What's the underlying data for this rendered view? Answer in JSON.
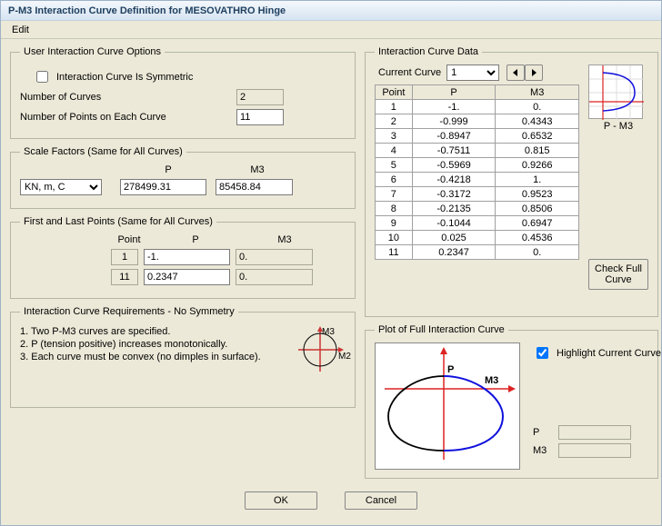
{
  "window": {
    "title": "P-M3 Interaction Curve Definition for MESOVATHRO Hinge"
  },
  "menu": {
    "edit": "Edit"
  },
  "userOptions": {
    "legend": "User Interaction Curve Options",
    "symmetric_label": "Interaction Curve Is Symmetric",
    "symmetric_checked": false,
    "num_curves_label": "Number of Curves",
    "num_curves_value": "2",
    "num_points_label": "Number of Points on Each Curve",
    "num_points_value": "11"
  },
  "scaleFactors": {
    "legend": "Scale Factors (Same for All Curves)",
    "units_dropdown": "KN, m, C",
    "hdr_p": "P",
    "hdr_m3": "M3",
    "p_value": "278499.31",
    "m3_value": "85458.84"
  },
  "firstLast": {
    "legend": "First and Last Points (Same for All Curves)",
    "hdr_point": "Point",
    "hdr_p": "P",
    "hdr_m3": "M3",
    "r1_point": "1",
    "r1_p": "-1.",
    "r1_m3": "0.",
    "r2_point": "11",
    "r2_p": "0.2347",
    "r2_m3": "0."
  },
  "requirements": {
    "legend": "Interaction Curve Requirements - No Symmetry",
    "item1": "1.  Two P-M3 curves are specified.",
    "item2": "2.  P (tension positive) increases monotonically.",
    "item3": "3.  Each curve must be convex (no dimples in surface).",
    "axis_p": "M3",
    "axis_m3": "M2"
  },
  "curveData": {
    "legend": "Interaction Curve Data",
    "current_curve_label": "Current Curve",
    "current_curve_value": "1",
    "col_point": "Point",
    "col_p": "P",
    "col_m3": "M3",
    "rows": [
      {
        "pt": "1",
        "p": "-1.",
        "m3": "0."
      },
      {
        "pt": "2",
        "p": "-0.999",
        "m3": "0.4343"
      },
      {
        "pt": "3",
        "p": "-0.8947",
        "m3": "0.6532"
      },
      {
        "pt": "4",
        "p": "-0.7511",
        "m3": "0.815"
      },
      {
        "pt": "5",
        "p": "-0.5969",
        "m3": "0.9266"
      },
      {
        "pt": "6",
        "p": "-0.4218",
        "m3": "1."
      },
      {
        "pt": "7",
        "p": "-0.3172",
        "m3": "0.9523"
      },
      {
        "pt": "8",
        "p": "-0.2135",
        "m3": "0.8506"
      },
      {
        "pt": "9",
        "p": "-0.1044",
        "m3": "0.6947"
      },
      {
        "pt": "10",
        "p": "0.025",
        "m3": "0.4536"
      },
      {
        "pt": "11",
        "p": "0.2347",
        "m3": "0."
      }
    ],
    "miniplot_label": "P - M3",
    "check_full_btn": "Check Full Curve"
  },
  "fullPlot": {
    "legend": "Plot of Full Interaction Curve",
    "highlight_label": "Highlight Current Curve",
    "highlight_checked": true,
    "axis_p": "P",
    "axis_m3": "M3",
    "readout_p": "P",
    "readout_m3": "M3"
  },
  "buttons": {
    "ok": "OK",
    "cancel": "Cancel"
  }
}
